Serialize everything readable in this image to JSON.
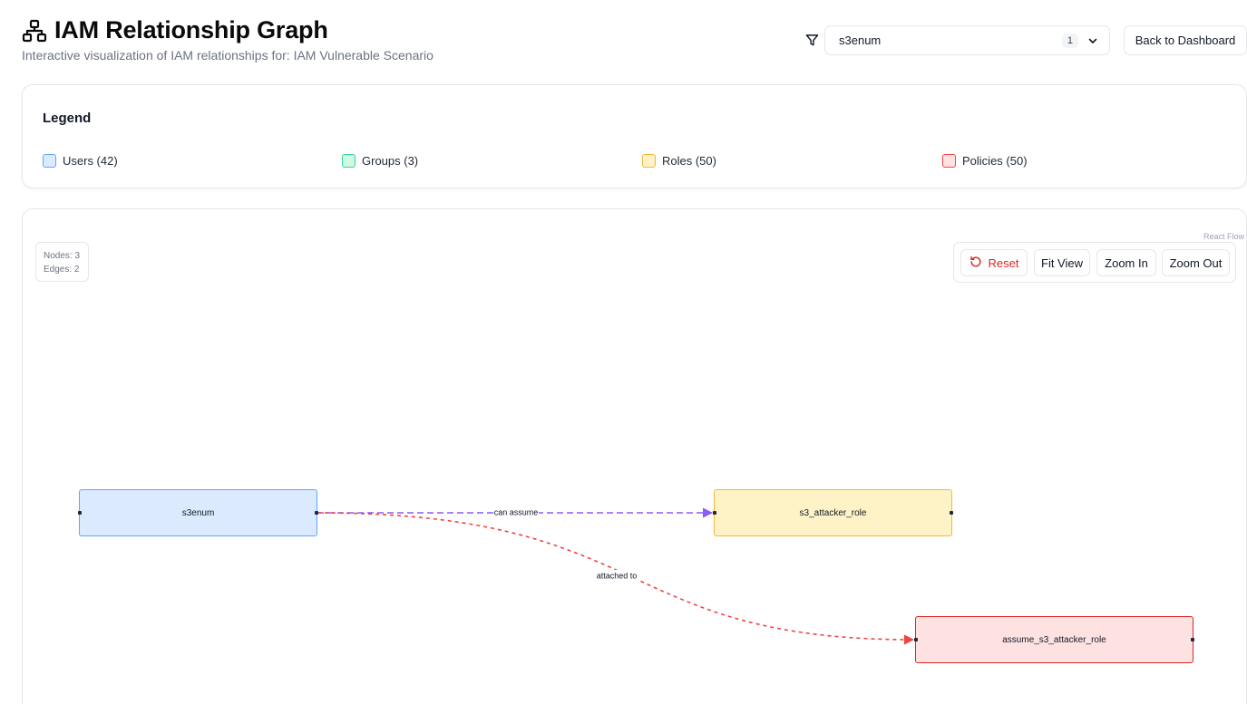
{
  "header": {
    "title": "IAM Relationship Graph",
    "subtitle": "Interactive visualization of IAM relationships for: IAM Vulnerable Scenario",
    "icon": "network-hierarchy-icon"
  },
  "filter": {
    "icon": "filter-icon",
    "selected_value": "s3enum",
    "selected_count": "1",
    "chevron_icon": "chevron-down-icon"
  },
  "back_button": {
    "label": "Back to Dashboard"
  },
  "legend": {
    "title": "Legend",
    "items": [
      {
        "label": "Users (42)",
        "fill": "#dbeafe",
        "border": "#60a5fa"
      },
      {
        "label": "Groups (3)",
        "fill": "#d1fae5",
        "border": "#34d399"
      },
      {
        "label": "Roles (50)",
        "fill": "#fef3c7",
        "border": "#f5b53a"
      },
      {
        "label": "Policies (50)",
        "fill": "#fee2e2",
        "border": "#ef4444"
      }
    ]
  },
  "graph": {
    "attribution": "React Flow",
    "stats": {
      "nodes": "Nodes: 3",
      "edges": "Edges: 2"
    },
    "controls": {
      "reset": "Reset",
      "fit_view": "Fit View",
      "zoom_in": "Zoom In",
      "zoom_out": "Zoom Out"
    },
    "nodes": [
      {
        "id": "s3enum",
        "label": "s3enum",
        "type": "user"
      },
      {
        "id": "s3_attacker_role",
        "label": "s3_attacker_role",
        "type": "role"
      },
      {
        "id": "assume_s3_attacker_role",
        "label": "assume_s3_attacker_role",
        "type": "policy"
      }
    ],
    "edges": [
      {
        "source": "s3enum",
        "target": "s3_attacker_role",
        "label": "can assume",
        "color": "#8b5cf6"
      },
      {
        "source": "s3enum",
        "target": "assume_s3_attacker_role",
        "label": "attached to",
        "color": "#ef4444"
      }
    ]
  }
}
